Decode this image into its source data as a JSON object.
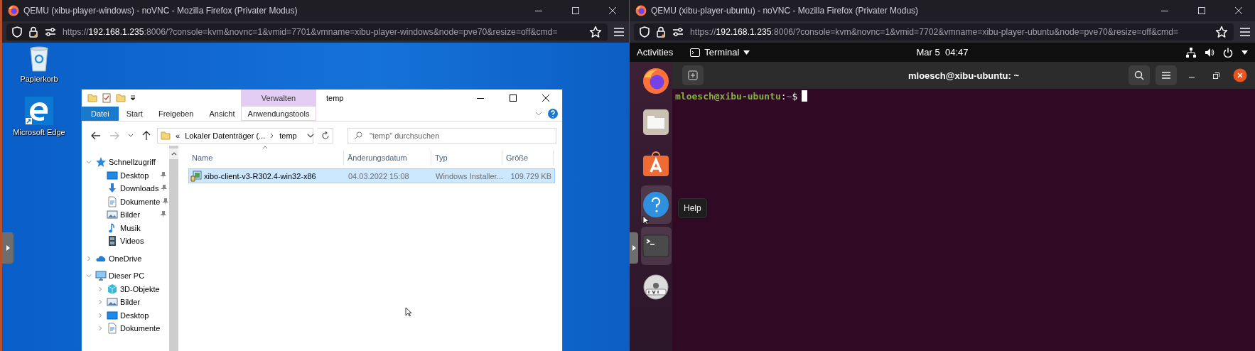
{
  "browsers": [
    {
      "title": "QEMU (xibu-player-windows) - noVNC - Mozilla Firefox (Privater Modus)",
      "url": {
        "scheme": "https://",
        "host": "192.168.1.235",
        "rest": ":8006/?console=kvm&novnc=1&vmid=7701&vmname=xibu-player-windows&node=pve70&resize=off&cmd="
      }
    },
    {
      "title": "QEMU (xibu-player-ubuntu) - noVNC - Mozilla Firefox (Privater Modus)",
      "url": {
        "scheme": "https://",
        "host": "192.168.1.235",
        "rest": ":8006/?console=kvm&novnc=1&vmid=7702&vmname=xibu-player-ubuntu&node=pve70&resize=off&cmd="
      }
    }
  ],
  "windows_vm": {
    "desktop_icons": [
      {
        "label": "Papierkorb",
        "kind": "recycle-bin"
      },
      {
        "label": "Microsoft Edge",
        "kind": "edge"
      }
    ],
    "explorer": {
      "context_group": "Verwalten",
      "title": "temp",
      "ribbon_tabs": [
        {
          "label": "Datei",
          "kind": "file"
        },
        {
          "label": "Start",
          "kind": "tab"
        },
        {
          "label": "Freigeben",
          "kind": "tab"
        },
        {
          "label": "Ansicht",
          "kind": "tab"
        },
        {
          "label": "Anwendungstools",
          "kind": "context"
        }
      ],
      "address": {
        "overflow": "«",
        "segments": [
          "Lokaler Datenträger (...",
          "temp"
        ]
      },
      "search": {
        "placeholder": "\"temp\" durchsuchen"
      },
      "nav_tree": [
        {
          "label": "Schnellzugriff",
          "kind": "star",
          "expanded": true,
          "children": [
            {
              "label": "Desktop",
              "kind": "desktop",
              "pinned": true
            },
            {
              "label": "Downloads",
              "kind": "download",
              "pinned": true
            },
            {
              "label": "Dokumente",
              "kind": "document",
              "pinned": true
            },
            {
              "label": "Bilder",
              "kind": "picture",
              "pinned": true
            },
            {
              "label": "Musik",
              "kind": "music",
              "pinned": false
            },
            {
              "label": "Videos",
              "kind": "video",
              "pinned": false
            }
          ]
        },
        {
          "label": "OneDrive",
          "kind": "cloud",
          "expanded": false
        },
        {
          "label": "Dieser PC",
          "kind": "pc",
          "expanded": true,
          "children": [
            {
              "label": "3D-Objekte",
              "kind": "cube",
              "expanded": false
            },
            {
              "label": "Bilder",
              "kind": "picture",
              "expanded": false
            },
            {
              "label": "Desktop",
              "kind": "desktop",
              "expanded": false
            },
            {
              "label": "Dokumente",
              "kind": "document",
              "expanded": false
            }
          ]
        }
      ],
      "columns": [
        "Name",
        "Änderungsdatum",
        "Typ",
        "Größe"
      ],
      "rows": [
        {
          "name": "xibo-client-v3-R302.4-win32-x86",
          "date": "04.03.2022 15:08",
          "type": "Windows Installer...",
          "size": "109.729 KB",
          "selected": true
        }
      ]
    }
  },
  "ubuntu_vm": {
    "top_bar": {
      "activities": "Activities",
      "app_menu": "Terminal",
      "clock": "Mar 5  04:47"
    },
    "dock": [
      {
        "kind": "firefox",
        "highlighted": false
      },
      {
        "kind": "files",
        "highlighted": false
      },
      {
        "kind": "software",
        "highlighted": false
      },
      {
        "kind": "help",
        "highlighted": true
      },
      {
        "kind": "terminal",
        "highlighted": true
      },
      {
        "kind": "dvd",
        "highlighted": false
      }
    ],
    "tooltip": "Help",
    "terminal": {
      "title": "mloesch@xibu-ubuntu: ~",
      "prompt": {
        "user_host": "mloesch@xibu-ubuntu",
        "separator": ":",
        "path": "~",
        "symbol": "$"
      }
    }
  }
}
